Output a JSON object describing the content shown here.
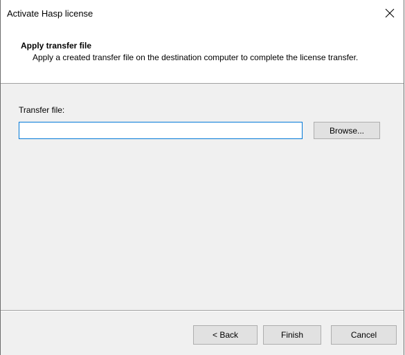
{
  "window": {
    "title": "Activate Hasp license",
    "close_icon": "close-icon"
  },
  "header": {
    "title": "Apply transfer file",
    "description": "Apply a created transfer file on the destination computer to complete the license transfer."
  },
  "form": {
    "transfer_file_label": "Transfer file:",
    "transfer_file_value": "",
    "transfer_file_placeholder": "",
    "browse_label": "Browse..."
  },
  "footer": {
    "back_label": "< Back",
    "finish_label": "Finish",
    "cancel_label": "Cancel"
  },
  "colors": {
    "input_focus_border": "#0078d7",
    "button_bg": "#e1e1e1",
    "dialog_bg": "#f0f0f0"
  }
}
